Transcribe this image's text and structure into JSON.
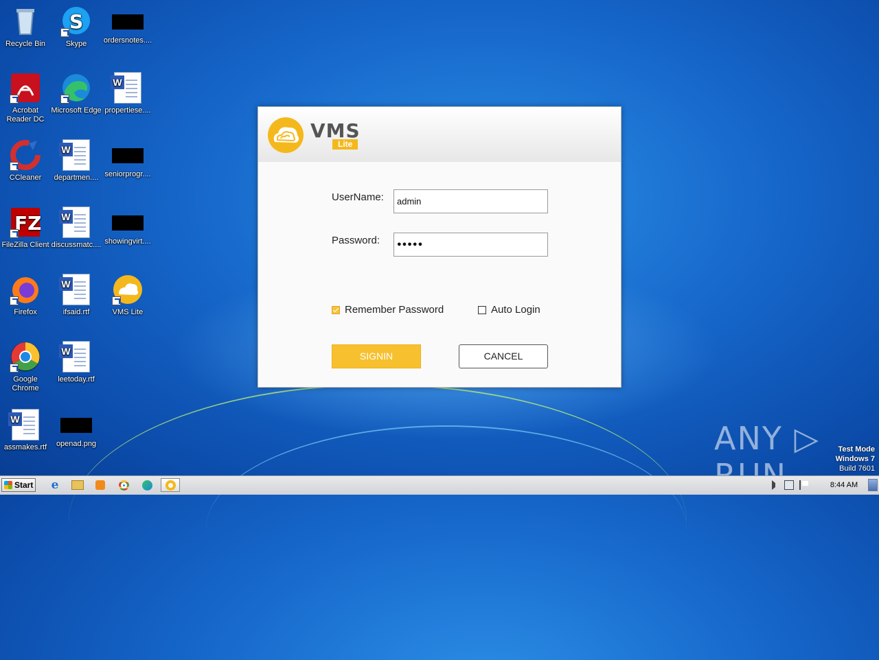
{
  "desktop": {
    "icons": [
      {
        "label": "Recycle Bin",
        "icon": "recycle-bin-icon"
      },
      {
        "label": "Skype",
        "icon": "skype-icon"
      },
      {
        "label": "ordersnotes....",
        "icon": "redacted-thumbnail"
      },
      {
        "label": "Acrobat Reader DC",
        "icon": "acrobat-icon"
      },
      {
        "label": "Microsoft Edge",
        "icon": "edge-icon"
      },
      {
        "label": "propertiese....",
        "icon": "word-document-icon"
      },
      {
        "label": "CCleaner",
        "icon": "ccleaner-icon"
      },
      {
        "label": "departmen....",
        "icon": "word-document-icon"
      },
      {
        "label": "seniorprogr....",
        "icon": "redacted-thumbnail"
      },
      {
        "label": "FileZilla Client",
        "icon": "filezilla-icon"
      },
      {
        "label": "discussmatc....",
        "icon": "word-document-icon"
      },
      {
        "label": "showingvirt....",
        "icon": "redacted-thumbnail"
      },
      {
        "label": "Firefox",
        "icon": "firefox-icon"
      },
      {
        "label": "ifsaid.rtf",
        "icon": "word-document-icon"
      },
      {
        "label": "VMS Lite",
        "icon": "vms-lite-icon"
      },
      {
        "label": "Google Chrome",
        "icon": "chrome-icon"
      },
      {
        "label": "leetoday.rtf",
        "icon": "word-document-icon"
      },
      {
        "label": "assmakes.rtf",
        "icon": "word-document-icon"
      },
      {
        "label": "openad.png",
        "icon": "redacted-thumbnail"
      }
    ]
  },
  "dialog": {
    "brand": "VMS",
    "brand_sub": "Lite",
    "username_label": "UserName:",
    "username_value": "admin",
    "password_label": "Password:",
    "password_value": "●●●●●",
    "remember_label": "Remember Password",
    "remember_checked": true,
    "autologin_label": "Auto Login",
    "autologin_checked": false,
    "signin_label": "SIGNIN",
    "cancel_label": "CANCEL",
    "accent_color": "#f7c02e"
  },
  "watermark": {
    "brand": "ANY ▷ RUN",
    "line1": "Test Mode",
    "line2": "Windows 7",
    "line3": "Build 7601"
  },
  "taskbar": {
    "start_label": "Start",
    "apps": [
      "internet-explorer-icon",
      "file-explorer-icon",
      "media-player-icon",
      "chrome-icon",
      "edge-icon",
      "vms-lite-icon"
    ],
    "clock": "8:44 AM"
  }
}
